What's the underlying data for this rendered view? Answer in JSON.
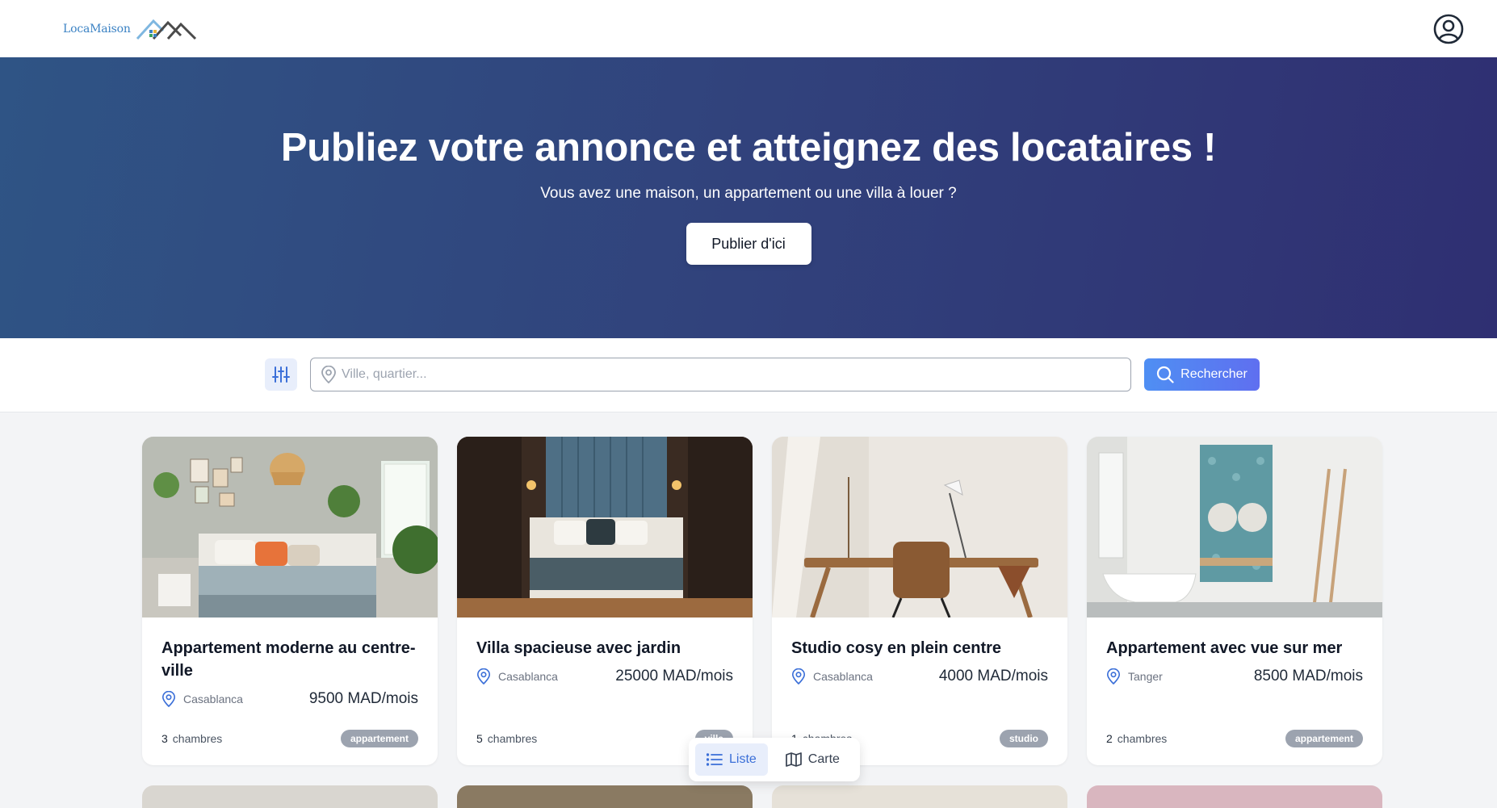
{
  "header": {
    "logo_text": "LocaMaison",
    "logo_icon": "house-roofs-logo",
    "account_icon": "user-circle-icon"
  },
  "hero": {
    "title": "Publiez votre annonce et atteignez des locataires !",
    "subtitle": "Vous avez une maison, un appartement ou une villa à louer ?",
    "cta_label": "Publier d'ici"
  },
  "search": {
    "filter_icon": "sliders-icon",
    "location_icon": "map-pin-icon",
    "placeholder": "Ville, quartier...",
    "value": "",
    "button_label": "Rechercher",
    "button_icon": "search-icon"
  },
  "listings": [
    {
      "title": "Appartement moderne au centre-ville",
      "city": "Casablanca",
      "price": "9500 MAD/mois",
      "rooms": "3",
      "rooms_label": "chambres",
      "type": "appartement"
    },
    {
      "title": "Villa spacieuse avec jardin",
      "city": "Casablanca",
      "price": "25000 MAD/mois",
      "rooms": "5",
      "rooms_label": "chambres",
      "type": "villa"
    },
    {
      "title": "Studio cosy en plein centre",
      "city": "Casablanca",
      "price": "4000 MAD/mois",
      "rooms": "1",
      "rooms_label": "chambres",
      "type": "studio"
    },
    {
      "title": "Appartement avec vue sur mer",
      "city": "Tanger",
      "price": "8500 MAD/mois",
      "rooms": "2",
      "rooms_label": "chambres",
      "type": "appartement"
    }
  ],
  "view_toggle": {
    "list_label": "Liste",
    "list_icon": "list-icon",
    "map_label": "Carte",
    "map_icon": "map-icon",
    "active": "Liste"
  },
  "colors": {
    "hero_start": "#2f5485",
    "hero_end": "#2f2f72",
    "accent": "#4f8ff3",
    "badge": "#9ca3af"
  }
}
